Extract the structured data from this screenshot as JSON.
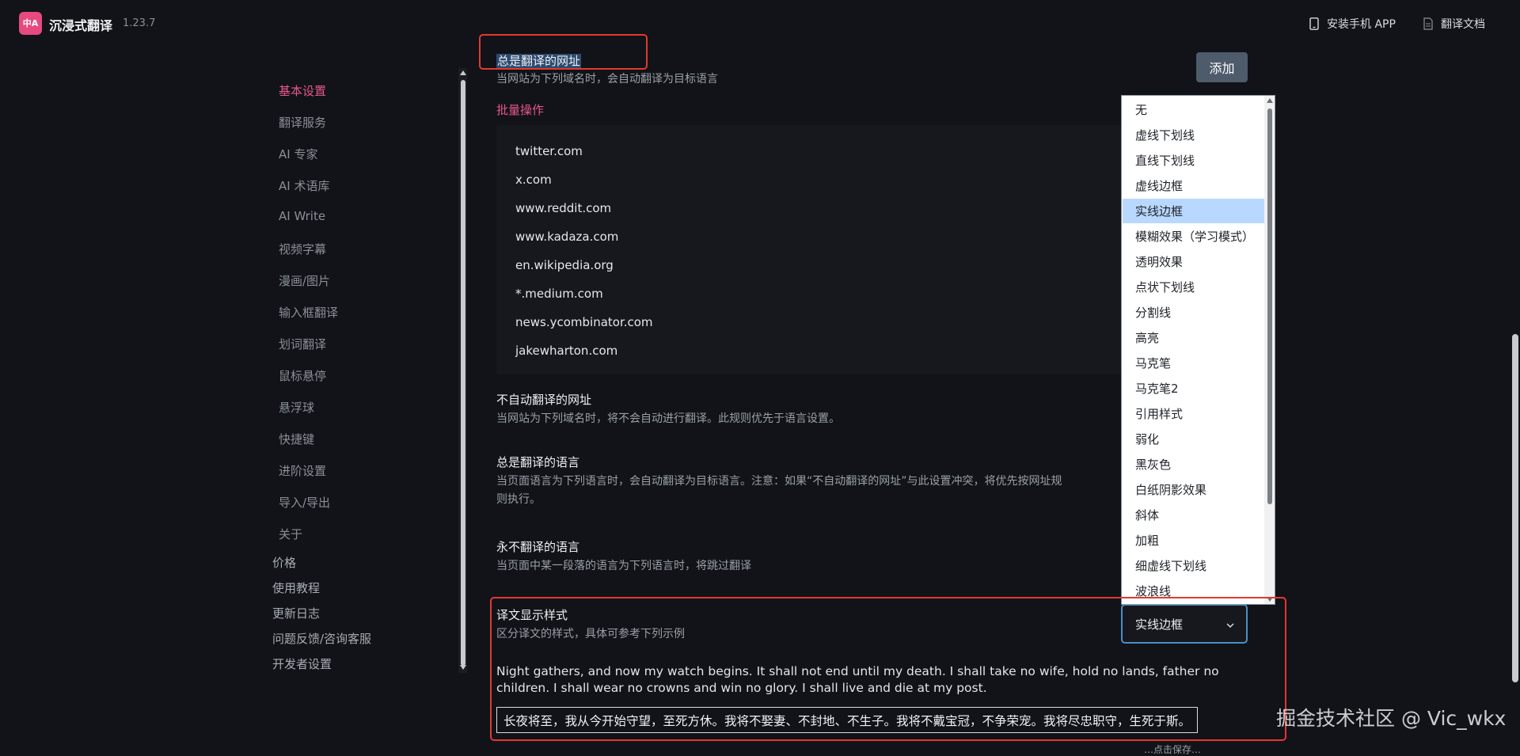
{
  "header": {
    "logo_text": "中A",
    "app_name": "沉浸式翻译",
    "version": "1.23.7",
    "install_app": "安装手机 APP",
    "docs": "翻译文档"
  },
  "sidebar": {
    "items": [
      {
        "label": "基本设置",
        "active": true
      },
      {
        "label": "翻译服务"
      },
      {
        "label": "AI 专家"
      },
      {
        "label": "AI 术语库"
      },
      {
        "label": "AI Write"
      },
      {
        "label": "视频字幕"
      },
      {
        "label": "漫画/图片"
      },
      {
        "label": "输入框翻译"
      },
      {
        "label": "划词翻译"
      },
      {
        "label": "鼠标悬停"
      },
      {
        "label": "悬浮球"
      },
      {
        "label": "快捷键"
      },
      {
        "label": "进阶设置"
      },
      {
        "label": "导入/导出"
      },
      {
        "label": "关于"
      }
    ],
    "links": [
      "价格",
      "使用教程",
      "更新日志",
      "问题反馈/咨询客服",
      "开发者设置"
    ]
  },
  "always_translate_sites": {
    "title": "总是翻译的网址",
    "desc": "当网站为下列域名时，会自动翻译为目标语言",
    "batch_label": "批量操作",
    "add_label": "添加",
    "urls": [
      "twitter.com",
      "x.com",
      "www.reddit.com",
      "www.kadaza.com",
      "en.wikipedia.org",
      "*.medium.com",
      "news.ycombinator.com",
      "jakewharton.com"
    ]
  },
  "never_translate_sites": {
    "title": "不自动翻译的网址",
    "desc": "当网站为下列域名时，将不会自动进行翻译。此规则优先于语言设置。"
  },
  "always_translate_langs": {
    "title": "总是翻译的语言",
    "desc_line1": "当页面语言为下列语言时，会自动翻译为目标语言。注意：如果“不自动翻译的网址”与此设置冲突，将优先按网址规",
    "desc_line2": "则执行。"
  },
  "never_translate_langs": {
    "title": "永不翻译的语言",
    "desc": "当页面中某一段落的语言为下列语言时，将跳过翻译"
  },
  "display_style": {
    "title": "译文显示样式",
    "desc": "区分译文的样式，具体可参考下列示例",
    "selected": "实线边框",
    "options": [
      "无",
      "虚线下划线",
      "直线下划线",
      "虚线边框",
      "实线边框",
      "模糊效果（学习模式）",
      "透明效果",
      "点状下划线",
      "分割线",
      "高亮",
      "马克笔",
      "马克笔2",
      "引用样式",
      "弱化",
      "黑灰色",
      "白纸阴影效果",
      "斜体",
      "加粗",
      "细虚线下划线",
      "波浪线"
    ],
    "sample_en": "Night gathers, and now my watch begins. It shall not end until my death. I shall take no wife, hold no lands, father no children. I shall wear no crowns and win no glory. I shall live and die at my post.",
    "sample_cn": "长夜将至，我从今开始守望，至死方休。我将不娶妻、不封地、不生子。我将不戴宝冠，不争荣宠。我将尽忠职守，生死于斯。"
  },
  "watermark": "掘金技术社区 @ Vic_wkx",
  "cut_text": "…点击保存…"
}
